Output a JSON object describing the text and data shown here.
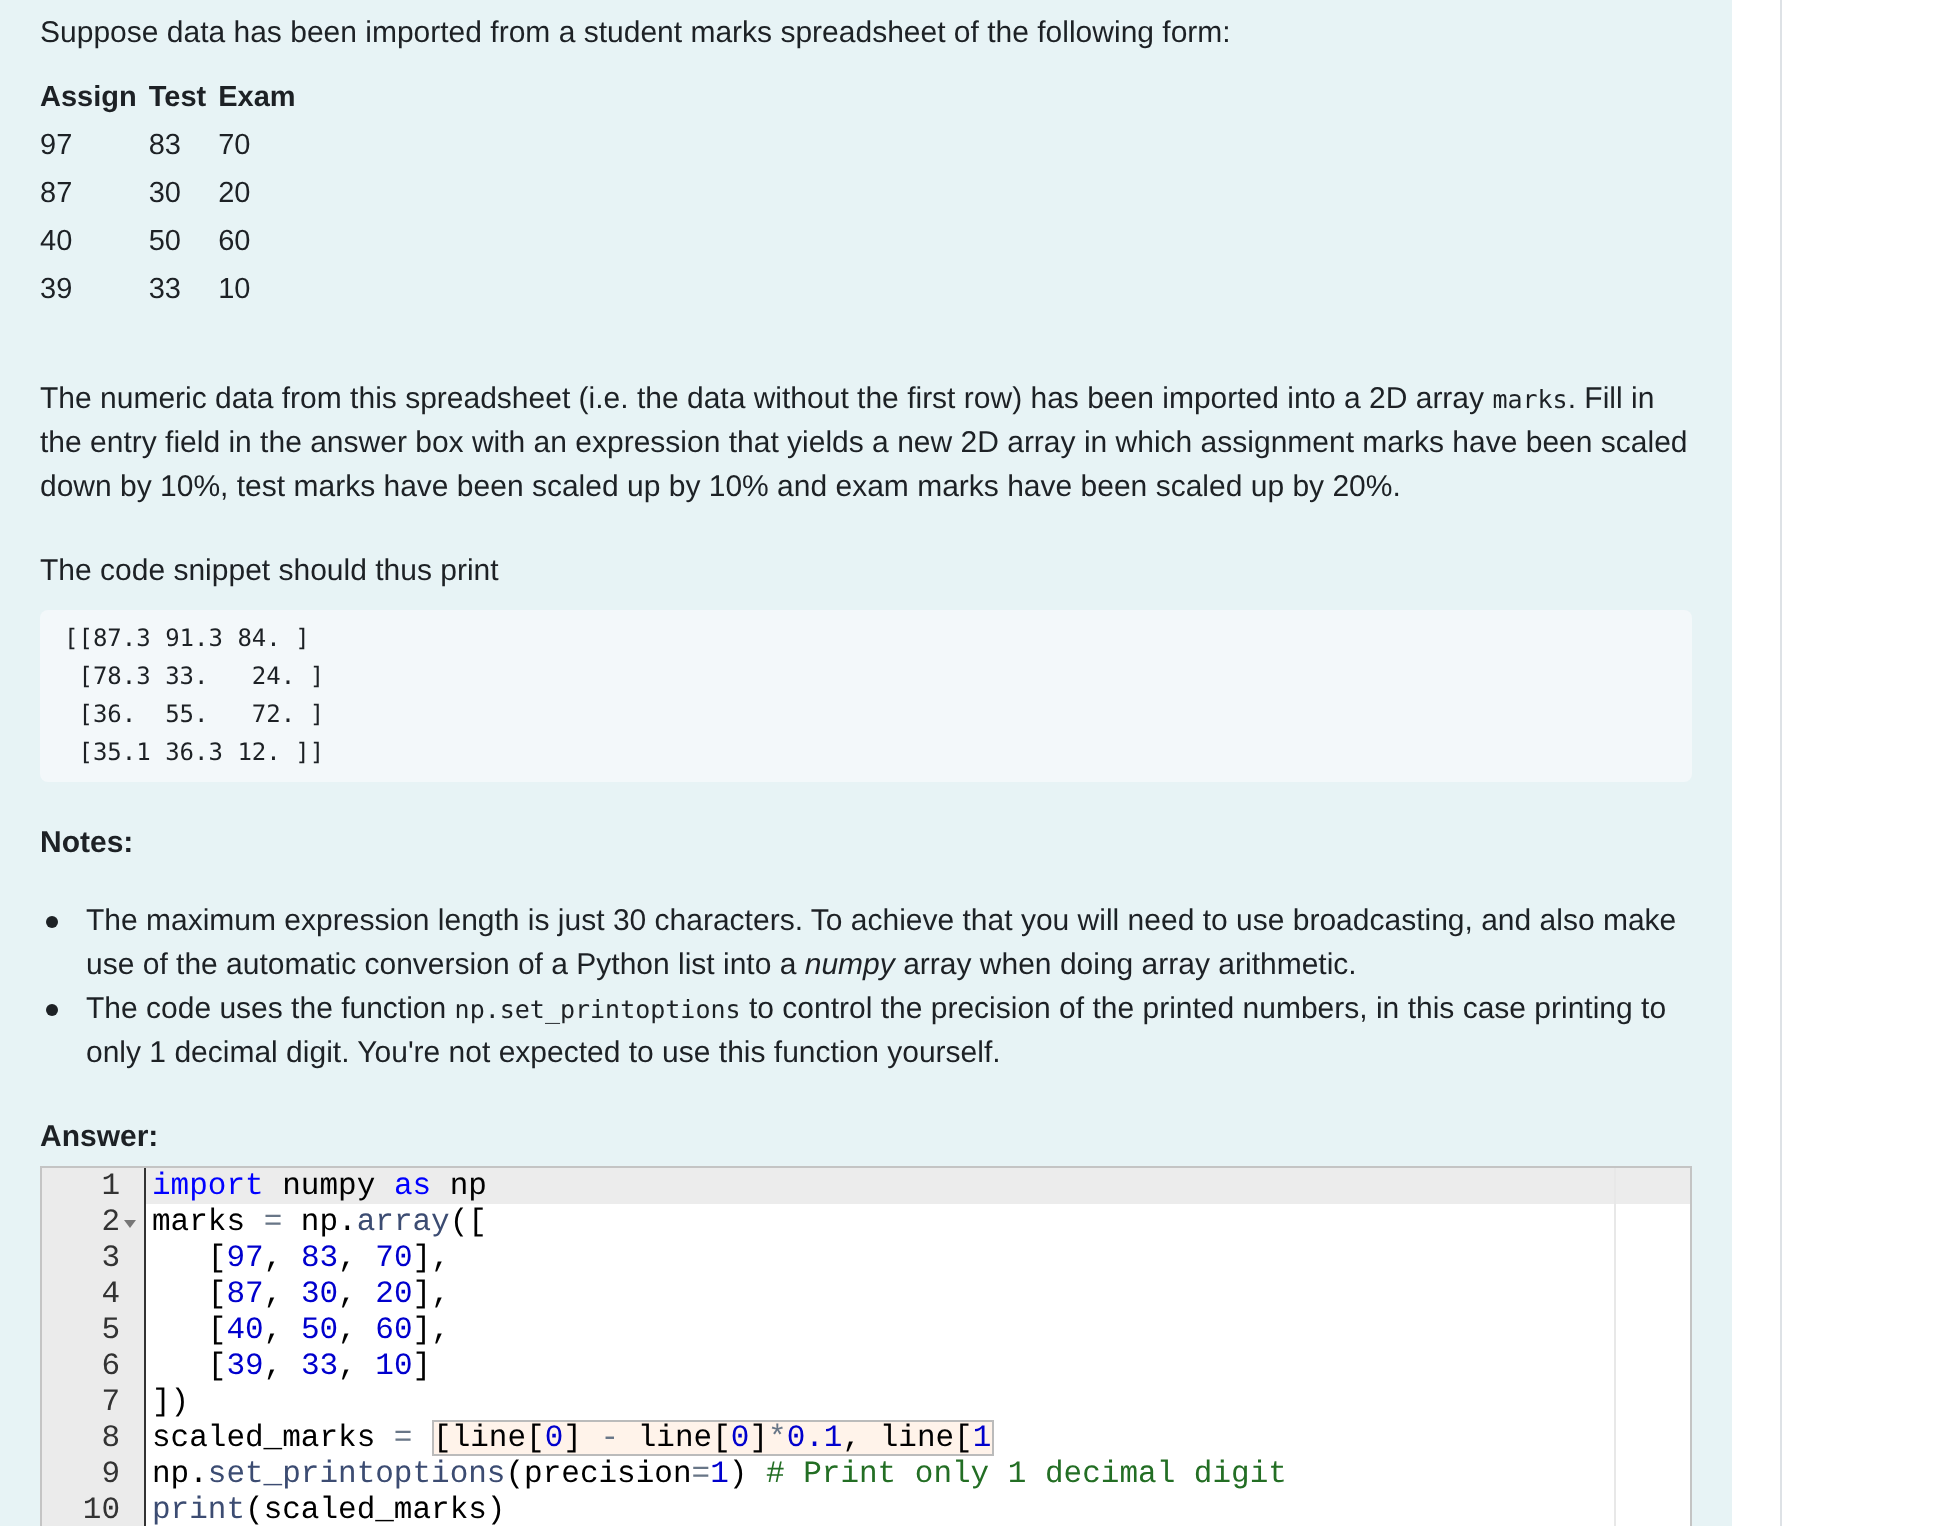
{
  "intro": "Suppose data has been imported from a student marks spreadsheet of the following form:",
  "table": {
    "columns": [
      "Assign",
      "Test",
      "Exam"
    ],
    "rows": [
      [
        "97",
        "83",
        "70"
      ],
      [
        "87",
        "30",
        "20"
      ],
      [
        "40",
        "50",
        "60"
      ],
      [
        "39",
        "33",
        "10"
      ]
    ]
  },
  "description": [
    {
      "kind": "text",
      "text": "The numeric data from this spreadsheet (i.e. the data without the first row) has been imported into a 2D array "
    },
    {
      "kind": "code",
      "text": "marks"
    },
    {
      "kind": "text",
      "text": ". Fill in the entry field in the answer box with an expression that yields a new 2D array in which assignment marks have been scaled down by 10%, test marks have been scaled up by 10% and exam marks have been scaled up by 20%."
    }
  ],
  "output_intro": "The code snippet should thus print",
  "expected_output": [
    "[[87.3 91.3 84. ]",
    " [78.3 33.   24. ]",
    " [36.  55.   72. ]",
    " [35.1 36.3 12. ]]"
  ],
  "notes_heading": "Notes:",
  "notes": [
    [
      {
        "kind": "text",
        "text": "The maximum expression length is just 30 characters. To achieve that you will need to use broadcasting, and also make use of the automatic conversion of a Python list into a *numpy* array when doing array arithmetic."
      }
    ],
    [
      {
        "kind": "text",
        "text": "The code uses the function "
      },
      {
        "kind": "code",
        "text": "np.set_printoptions"
      },
      {
        "kind": "text",
        "text": " to control the precision of the printed numbers, in this case printing to only 1 decimal digit. You're not expected to use this function yourself."
      }
    ]
  ],
  "answer_heading": "Answer:",
  "code_lines": [
    {
      "number": "1",
      "selected": true,
      "fold": false,
      "tokens": [
        {
          "kind": "keyword",
          "text": "import"
        },
        {
          "kind": "plain",
          "text": " numpy "
        },
        {
          "kind": "keyword",
          "text": "as"
        },
        {
          "kind": "plain",
          "text": " np"
        }
      ]
    },
    {
      "number": "2",
      "selected": false,
      "fold": true,
      "tokens": [
        {
          "kind": "plain",
          "text": "marks "
        },
        {
          "kind": "operator",
          "text": "="
        },
        {
          "kind": "plain",
          "text": " np."
        },
        {
          "kind": "builtin",
          "text": "array"
        },
        {
          "kind": "plain",
          "text": "(["
        }
      ]
    },
    {
      "number": "3",
      "selected": false,
      "fold": false,
      "tokens": [
        {
          "kind": "plain",
          "text": "   ["
        },
        {
          "kind": "number",
          "text": "97"
        },
        {
          "kind": "plain",
          "text": ", "
        },
        {
          "kind": "number",
          "text": "83"
        },
        {
          "kind": "plain",
          "text": ", "
        },
        {
          "kind": "number",
          "text": "70"
        },
        {
          "kind": "plain",
          "text": "],"
        }
      ]
    },
    {
      "number": "4",
      "selected": false,
      "fold": false,
      "tokens": [
        {
          "kind": "plain",
          "text": "   ["
        },
        {
          "kind": "number",
          "text": "87"
        },
        {
          "kind": "plain",
          "text": ", "
        },
        {
          "kind": "number",
          "text": "30"
        },
        {
          "kind": "plain",
          "text": ", "
        },
        {
          "kind": "number",
          "text": "20"
        },
        {
          "kind": "plain",
          "text": "],"
        }
      ]
    },
    {
      "number": "5",
      "selected": false,
      "fold": false,
      "tokens": [
        {
          "kind": "plain",
          "text": "   ["
        },
        {
          "kind": "number",
          "text": "40"
        },
        {
          "kind": "plain",
          "text": ", "
        },
        {
          "kind": "number",
          "text": "50"
        },
        {
          "kind": "plain",
          "text": ", "
        },
        {
          "kind": "number",
          "text": "60"
        },
        {
          "kind": "plain",
          "text": "],"
        }
      ]
    },
    {
      "number": "6",
      "selected": false,
      "fold": false,
      "tokens": [
        {
          "kind": "plain",
          "text": "   ["
        },
        {
          "kind": "number",
          "text": "39"
        },
        {
          "kind": "plain",
          "text": ", "
        },
        {
          "kind": "number",
          "text": "33"
        },
        {
          "kind": "plain",
          "text": ", "
        },
        {
          "kind": "number",
          "text": "10"
        },
        {
          "kind": "plain",
          "text": "]"
        }
      ]
    },
    {
      "number": "7",
      "selected": false,
      "fold": false,
      "tokens": [
        {
          "kind": "plain",
          "text": "])"
        }
      ]
    },
    {
      "number": "8",
      "selected": false,
      "fold": false,
      "tokens": [
        {
          "kind": "plain",
          "text": "scaled_marks "
        },
        {
          "kind": "operator",
          "text": "="
        }
      ],
      "field": [
        {
          "kind": "plain",
          "text": "[line["
        },
        {
          "kind": "number",
          "text": "0"
        },
        {
          "kind": "plain",
          "text": "] "
        },
        {
          "kind": "operator",
          "text": "-"
        },
        {
          "kind": "plain",
          "text": " line["
        },
        {
          "kind": "number",
          "text": "0"
        },
        {
          "kind": "plain",
          "text": "]"
        },
        {
          "kind": "operator",
          "text": "*"
        },
        {
          "kind": "number",
          "text": "0.1"
        },
        {
          "kind": "plain",
          "text": ", line["
        },
        {
          "kind": "number",
          "text": "1"
        }
      ]
    },
    {
      "number": "9",
      "selected": false,
      "fold": false,
      "tokens": [
        {
          "kind": "plain",
          "text": "np."
        },
        {
          "kind": "builtin",
          "text": "set_printoptions"
        },
        {
          "kind": "plain",
          "text": "(precision"
        },
        {
          "kind": "operator",
          "text": "="
        },
        {
          "kind": "number",
          "text": "1"
        },
        {
          "kind": "plain",
          "text": ") "
        },
        {
          "kind": "comment",
          "text": "# Print only 1 decimal digit"
        }
      ]
    },
    {
      "number": "10",
      "selected": false,
      "fold": false,
      "tokens": [
        {
          "kind": "builtin",
          "text": "print"
        },
        {
          "kind": "plain",
          "text": "(scaled_marks)"
        }
      ]
    }
  ]
}
